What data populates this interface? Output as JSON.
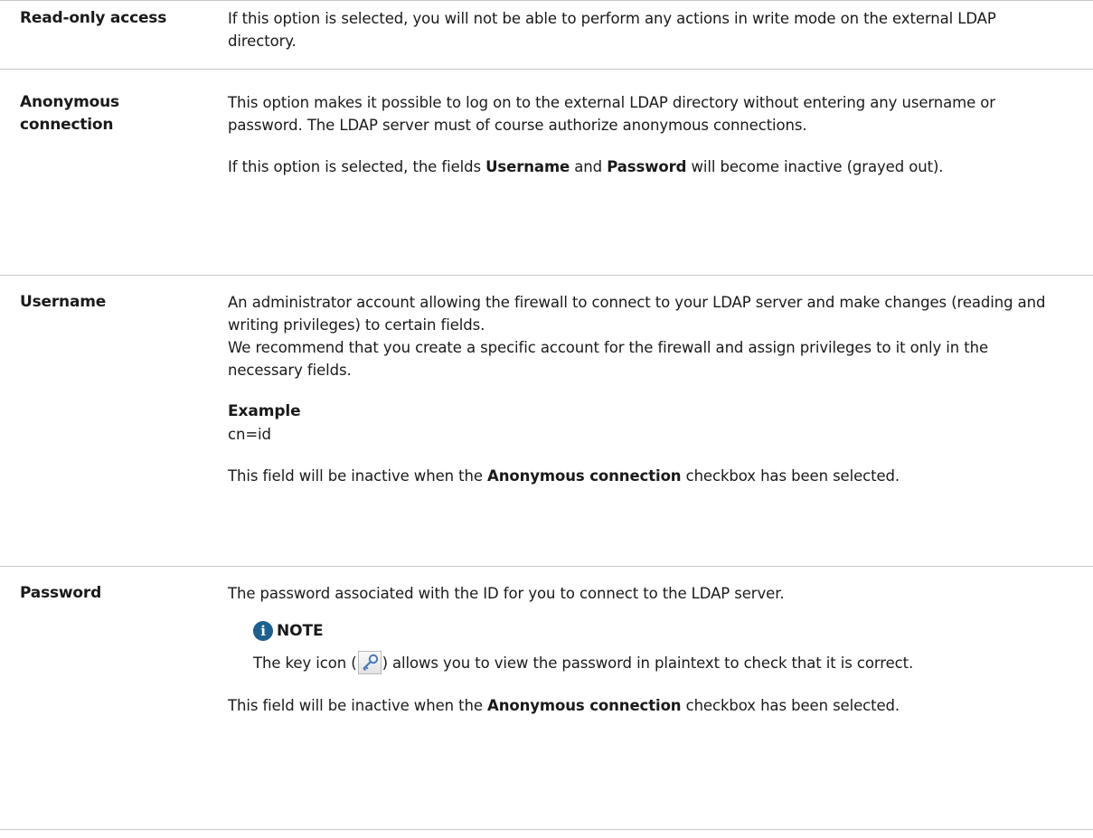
{
  "rows": [
    {
      "term": "Read-only access",
      "p1": "If this option is selected, you will not be able to perform any actions in write mode on the external LDAP directory."
    },
    {
      "term_line1": "Anonymous",
      "term_line2": "connection",
      "p1": "This option makes it possible to log on to the external LDAP directory without entering any username or password. The LDAP server must of course authorize anonymous connections.",
      "p2_a": "If this option is selected, the fields ",
      "p2_b": "Username",
      "p2_c": " and ",
      "p2_d": "Password",
      "p2_e": " will become inactive (grayed out)."
    },
    {
      "term": "Username",
      "p1_line1": "An administrator account allowing the firewall to connect to your LDAP server and make changes (reading and writing privileges) to certain fields.",
      "p1_line2": "We recommend that you create a specific account for the firewall and assign privileges to it only in the necessary fields.",
      "example_label": "Example",
      "example_value": "cn=id",
      "p3_a": "This field will be inactive when the ",
      "p3_b": "Anonymous connection",
      "p3_c": " checkbox has been selected."
    },
    {
      "term": "Password",
      "p1": "The password associated with the ID for you to connect to the LDAP server.",
      "note_label": "NOTE",
      "note_icon": "i",
      "note_a": "The key icon (",
      "note_b": ") allows you to view the password in plaintext to check that it is correct.",
      "p3_a": "This field will be inactive when the ",
      "p3_b": "Anonymous connection",
      "p3_c": " checkbox has been selected."
    }
  ]
}
